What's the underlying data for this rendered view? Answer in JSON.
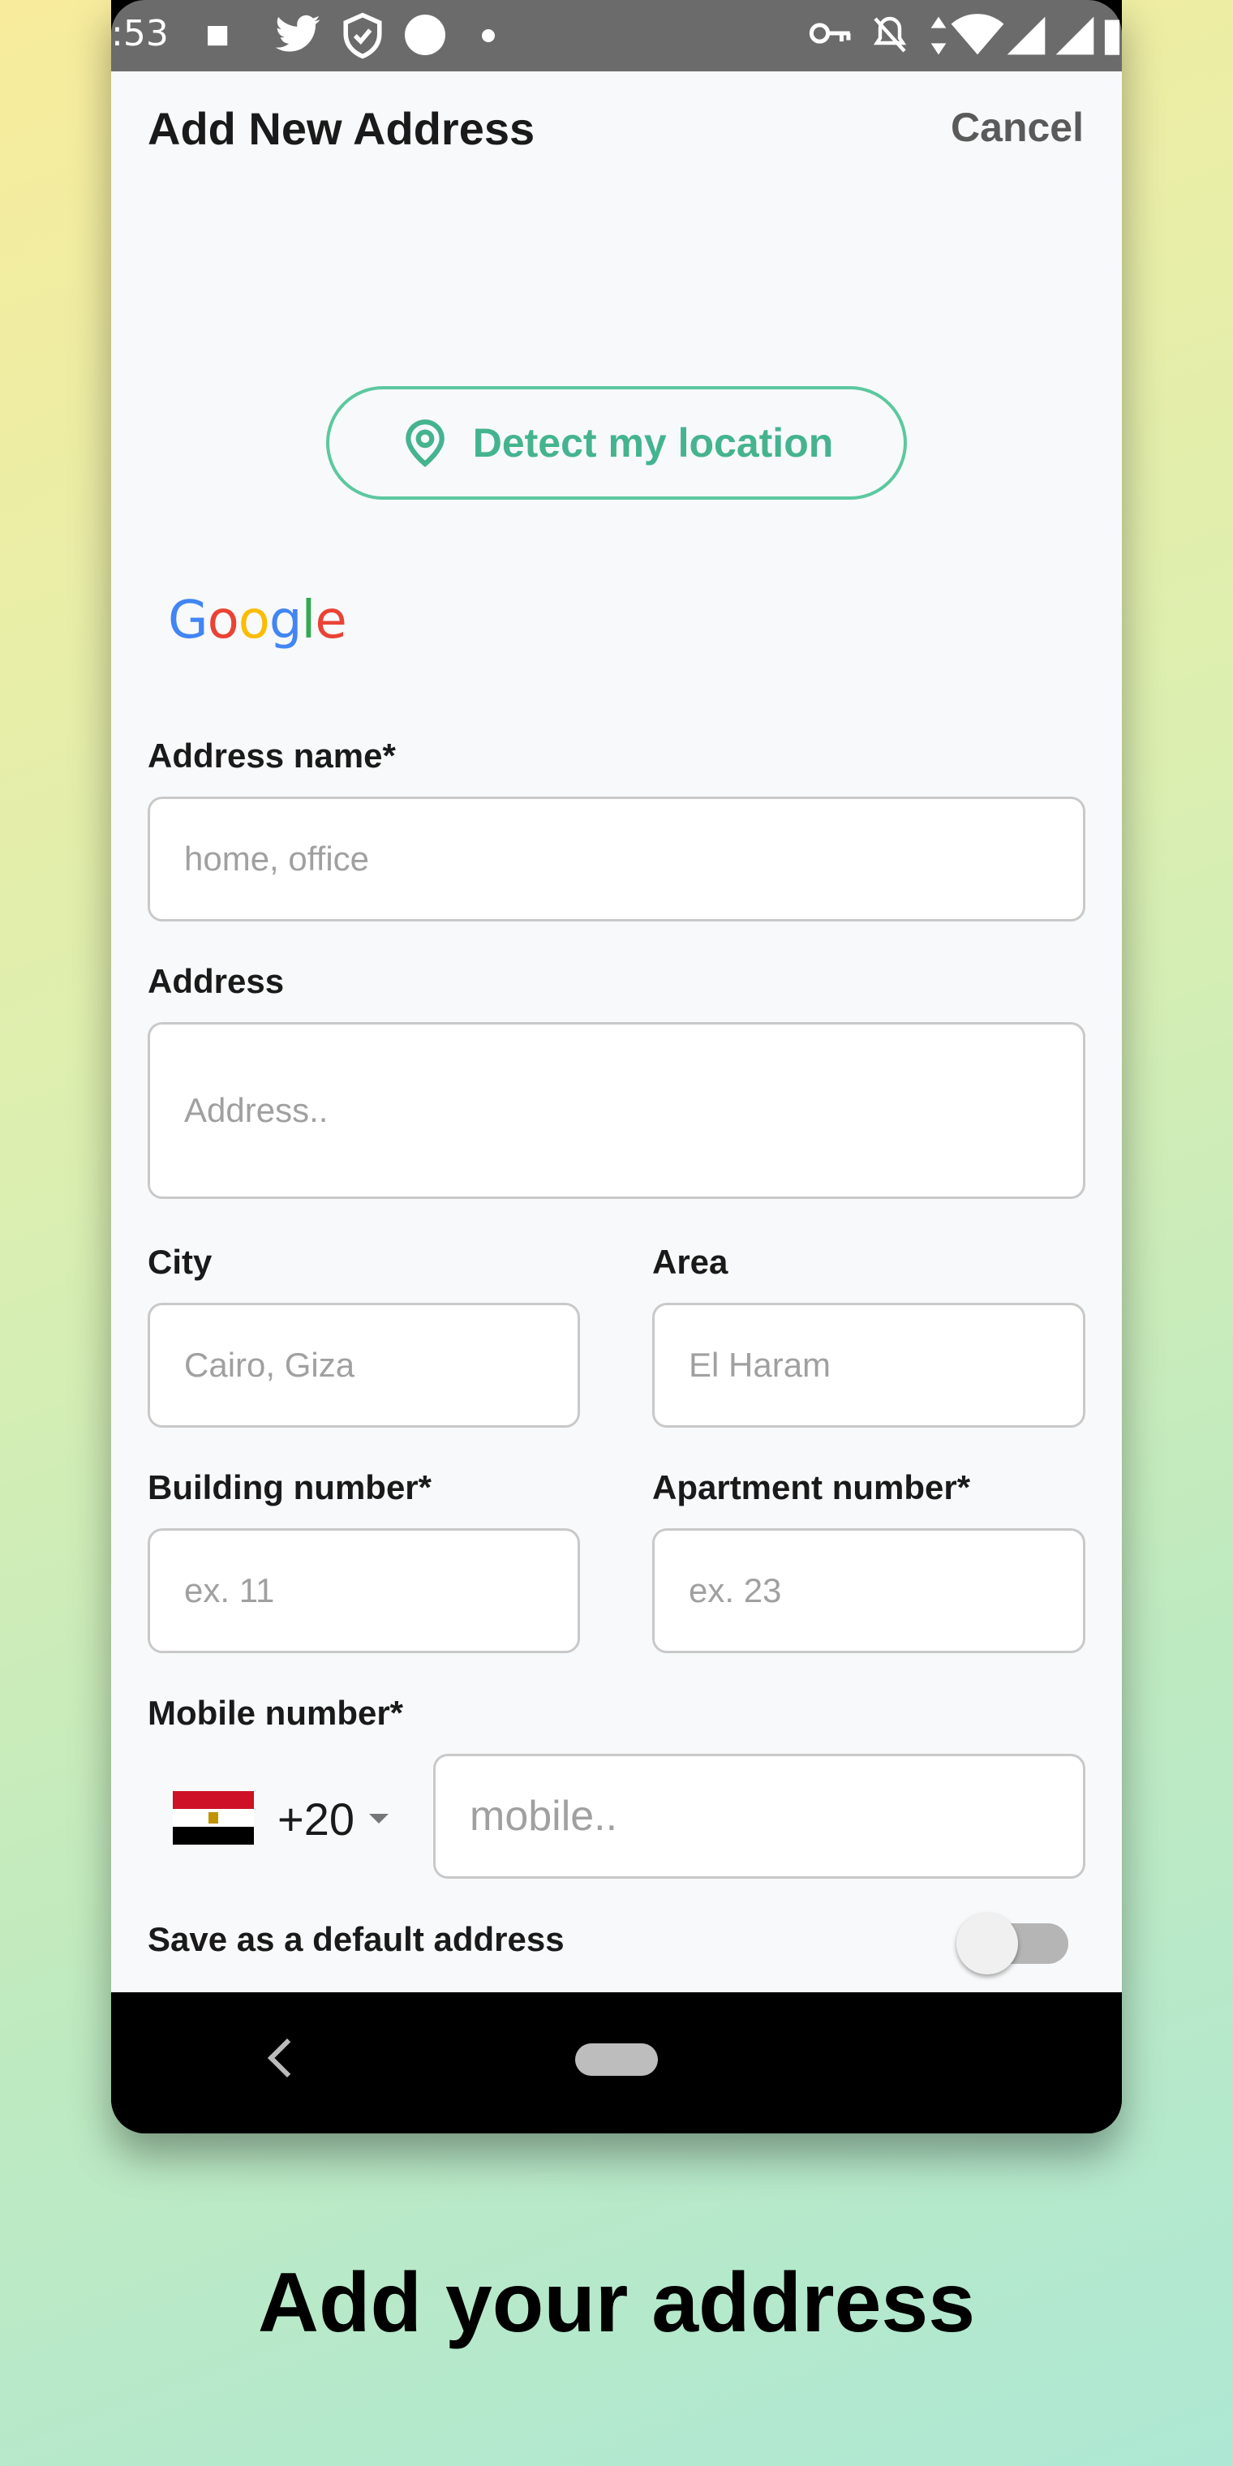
{
  "status_bar": {
    "time": ":53",
    "icons": [
      "puzzle-icon",
      "twitter-icon",
      "shield-icon",
      "circle-icon",
      "dot-icon",
      "key-icon",
      "bell-off-icon",
      "data-arrows-icon",
      "wifi-icon",
      "signal-icon",
      "signal-icon",
      "battery-icon"
    ]
  },
  "header": {
    "title": "Add New Address",
    "cancel_label": "Cancel"
  },
  "detect_button": {
    "label": "Detect my location",
    "icon": "location-pin-icon",
    "color": "#45b48e"
  },
  "google_logo": {
    "letters": [
      "G",
      "o",
      "o",
      "g",
      "l",
      "e"
    ],
    "colors": [
      "#4285f4",
      "#ea4335",
      "#fbbc05",
      "#4285f4",
      "#34a853",
      "#ea4335"
    ]
  },
  "form": {
    "address_name": {
      "label": "Address name*",
      "placeholder": "home, office"
    },
    "address": {
      "label": "Address",
      "placeholder": "Address.."
    },
    "city": {
      "label": "City",
      "placeholder": "Cairo, Giza"
    },
    "area": {
      "label": "Area",
      "placeholder": "El Haram"
    },
    "building_number": {
      "label": "Building number*",
      "placeholder": "ex. 11"
    },
    "apartment_number": {
      "label": "Apartment number*",
      "placeholder": "ex. 23"
    },
    "mobile_number": {
      "label": "Mobile number*",
      "country_code": "+20",
      "placeholder": "mobile.."
    },
    "default_address": {
      "label": "Save as a default address",
      "enabled": false
    }
  },
  "caption": "Add your address"
}
